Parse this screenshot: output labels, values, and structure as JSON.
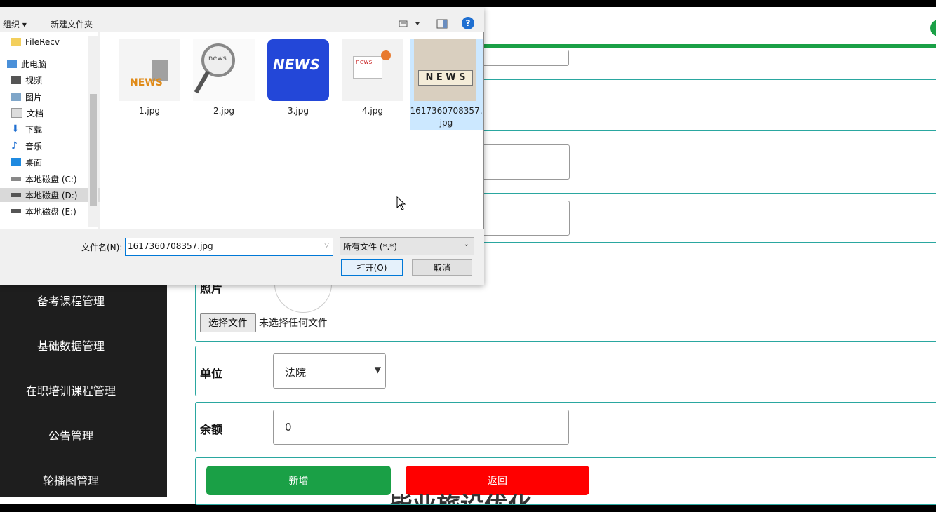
{
  "dialog": {
    "toolbar": {
      "organize_label": "组织 ▾",
      "new_folder_label": "新建文件夹",
      "view_icon": "view-icon",
      "help_icon": "help-icon"
    },
    "nav": [
      {
        "label": "FileRecv",
        "icon": "folder-icon"
      },
      {
        "label": "此电脑",
        "icon": "computer-icon"
      },
      {
        "label": "视频",
        "icon": "video-icon"
      },
      {
        "label": "图片",
        "icon": "picture-icon"
      },
      {
        "label": "文档",
        "icon": "document-icon"
      },
      {
        "label": "下载",
        "icon": "download-icon"
      },
      {
        "label": "音乐",
        "icon": "music-icon"
      },
      {
        "label": "桌面",
        "icon": "desktop-icon"
      },
      {
        "label": "本地磁盘 (C:)",
        "icon": "drive-icon"
      },
      {
        "label": "本地磁盘 (D:)",
        "icon": "drive-icon"
      },
      {
        "label": "本地磁盘 (E:)",
        "icon": "drive-icon"
      }
    ],
    "files": [
      {
        "name": "1.jpg",
        "thumb_text": "NEWS"
      },
      {
        "name": "2.jpg",
        "thumb_text": "news"
      },
      {
        "name": "3.jpg",
        "thumb_text": "NEWS"
      },
      {
        "name": "4.jpg",
        "thumb_text": "news"
      },
      {
        "name": "1617360708357.jpg",
        "thumb_text": "N E W S"
      }
    ],
    "filename_label": "文件名(N):",
    "filename_value": "1617360708357.jpg",
    "filetype_value": "所有文件 (*.*)",
    "open_label": "打开(O)",
    "cancel_label": "取消"
  },
  "page": {
    "sidebar": [
      "备考课程管理",
      "基础数据管理",
      "在职培训课程管理",
      "公告管理",
      "轮播图管理"
    ],
    "photo": {
      "label": "照片",
      "choose_file_label": "选择文件",
      "no_file_text": "未选择任何文件"
    },
    "unit": {
      "label": "单位",
      "value": "法院"
    },
    "balance": {
      "label": "余额",
      "value": "0"
    },
    "buttons": {
      "add_label": "新增",
      "back_label": "返回"
    },
    "footer_text": "毕业旅设优化"
  },
  "colors": {
    "green": "#1aa046",
    "red": "#ff0000",
    "sidebar_bg": "#1e1e1e",
    "row_border": "#2aa7a0"
  }
}
